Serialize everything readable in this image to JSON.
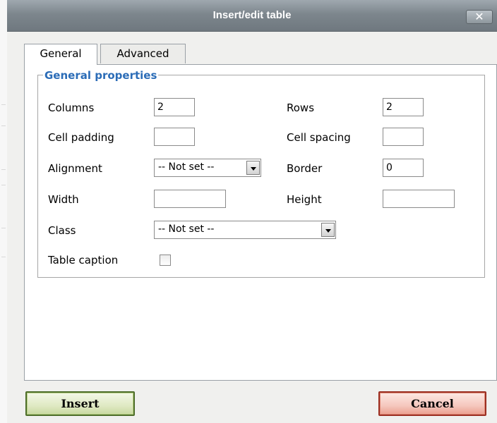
{
  "window": {
    "title": "Insert/edit table",
    "close_glyph": "✕"
  },
  "tabs": [
    {
      "label": "General",
      "active": true
    },
    {
      "label": "Advanced",
      "active": false
    }
  ],
  "general": {
    "legend": "General properties",
    "columns": {
      "label": "Columns",
      "value": "2"
    },
    "rows": {
      "label": "Rows",
      "value": "2"
    },
    "cell_padding": {
      "label": "Cell padding",
      "value": ""
    },
    "cell_spacing": {
      "label": "Cell spacing",
      "value": ""
    },
    "alignment": {
      "label": "Alignment",
      "value": "-- Not set --"
    },
    "border": {
      "label": "Border",
      "value": "0"
    },
    "width": {
      "label": "Width",
      "value": ""
    },
    "height": {
      "label": "Height",
      "value": ""
    },
    "class": {
      "label": "Class",
      "value": "-- Not set --"
    },
    "table_caption": {
      "label": "Table caption",
      "checked": false
    }
  },
  "buttons": {
    "insert": "Insert",
    "cancel": "Cancel"
  },
  "colors": {
    "legend": "#2b6cb7",
    "insert_border": "#4e6e2a",
    "cancel_border": "#9b2f22"
  }
}
